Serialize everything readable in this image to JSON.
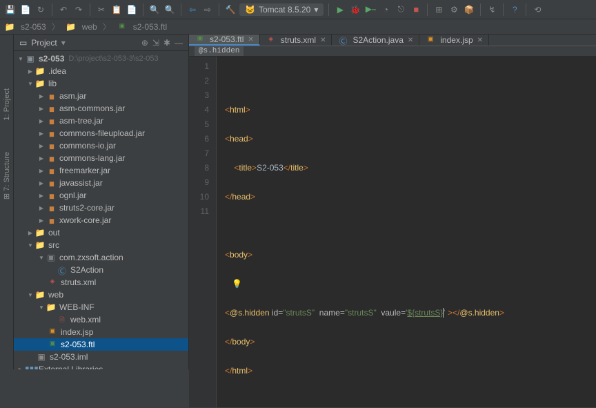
{
  "toolbar": {
    "config_label": "Tomcat 8.5.20"
  },
  "nav": {
    "project": "s2-053",
    "folder": "web",
    "file": "s2-053.ftl"
  },
  "panel": {
    "title": "Project"
  },
  "tree": {
    "root": "s2-053",
    "root_path": "D:\\project\\s2-053-3\\s2-053",
    "idea": ".idea",
    "lib": "lib",
    "jars": [
      "asm.jar",
      "asm-commons.jar",
      "asm-tree.jar",
      "commons-fileupload.jar",
      "commons-io.jar",
      "commons-lang.jar",
      "freemarker.jar",
      "javassist.jar",
      "ognl.jar",
      "struts2-core.jar",
      "xwork-core.jar"
    ],
    "out": "out",
    "src": "src",
    "pkg": "com.zxsoft.action",
    "cls": "S2Action",
    "struts_xml": "struts.xml",
    "web": "web",
    "webinf": "WEB-INF",
    "webxml": "web.xml",
    "indexjsp": "index.jsp",
    "ftl": "s2-053.ftl",
    "iml": "s2-053.iml",
    "ext": "External Libraries"
  },
  "tabs": [
    {
      "label": "s2-053.ftl",
      "icon": "ftl",
      "active": true
    },
    {
      "label": "struts.xml",
      "icon": "xml",
      "active": false
    },
    {
      "label": "S2Action.java",
      "icon": "cls",
      "active": false
    },
    {
      "label": "index.jsp",
      "icon": "jsp",
      "active": false
    }
  ],
  "breadcrumb": "@s.hidden",
  "code": {
    "lines": [
      "1",
      "2",
      "3",
      "4",
      "5",
      "6",
      "7",
      "8",
      "9",
      "10",
      "11"
    ],
    "l2": {
      "o": "<",
      "n": "html",
      "c": ">"
    },
    "l3": {
      "o": "<",
      "n": "head",
      "c": ">"
    },
    "l4": {
      "o": "<",
      "n": "title",
      "c": ">",
      "t": "S2-053",
      "o2": "</",
      "c2": ">"
    },
    "l5": {
      "o": "</",
      "n": "head",
      "c": ">"
    },
    "l7": {
      "o": "<",
      "n": "body",
      "c": ">"
    },
    "l9": {
      "o": "<",
      "n": "@s.hidden",
      "a1": " id=",
      "v1": "\"strutsS\"",
      "a2": "  name=",
      "v2": "\"strutsS\"",
      "a3": "  vaule=",
      "v3a": "'",
      "v3b": "${strutsS}",
      "v3c": "'",
      "sp": " >",
      "o2": "</",
      "c2": ">"
    },
    "l10": {
      "o": "</",
      "n": "body",
      "c": ">"
    },
    "l11": {
      "o": "</",
      "n": "html",
      "c": ">"
    }
  }
}
